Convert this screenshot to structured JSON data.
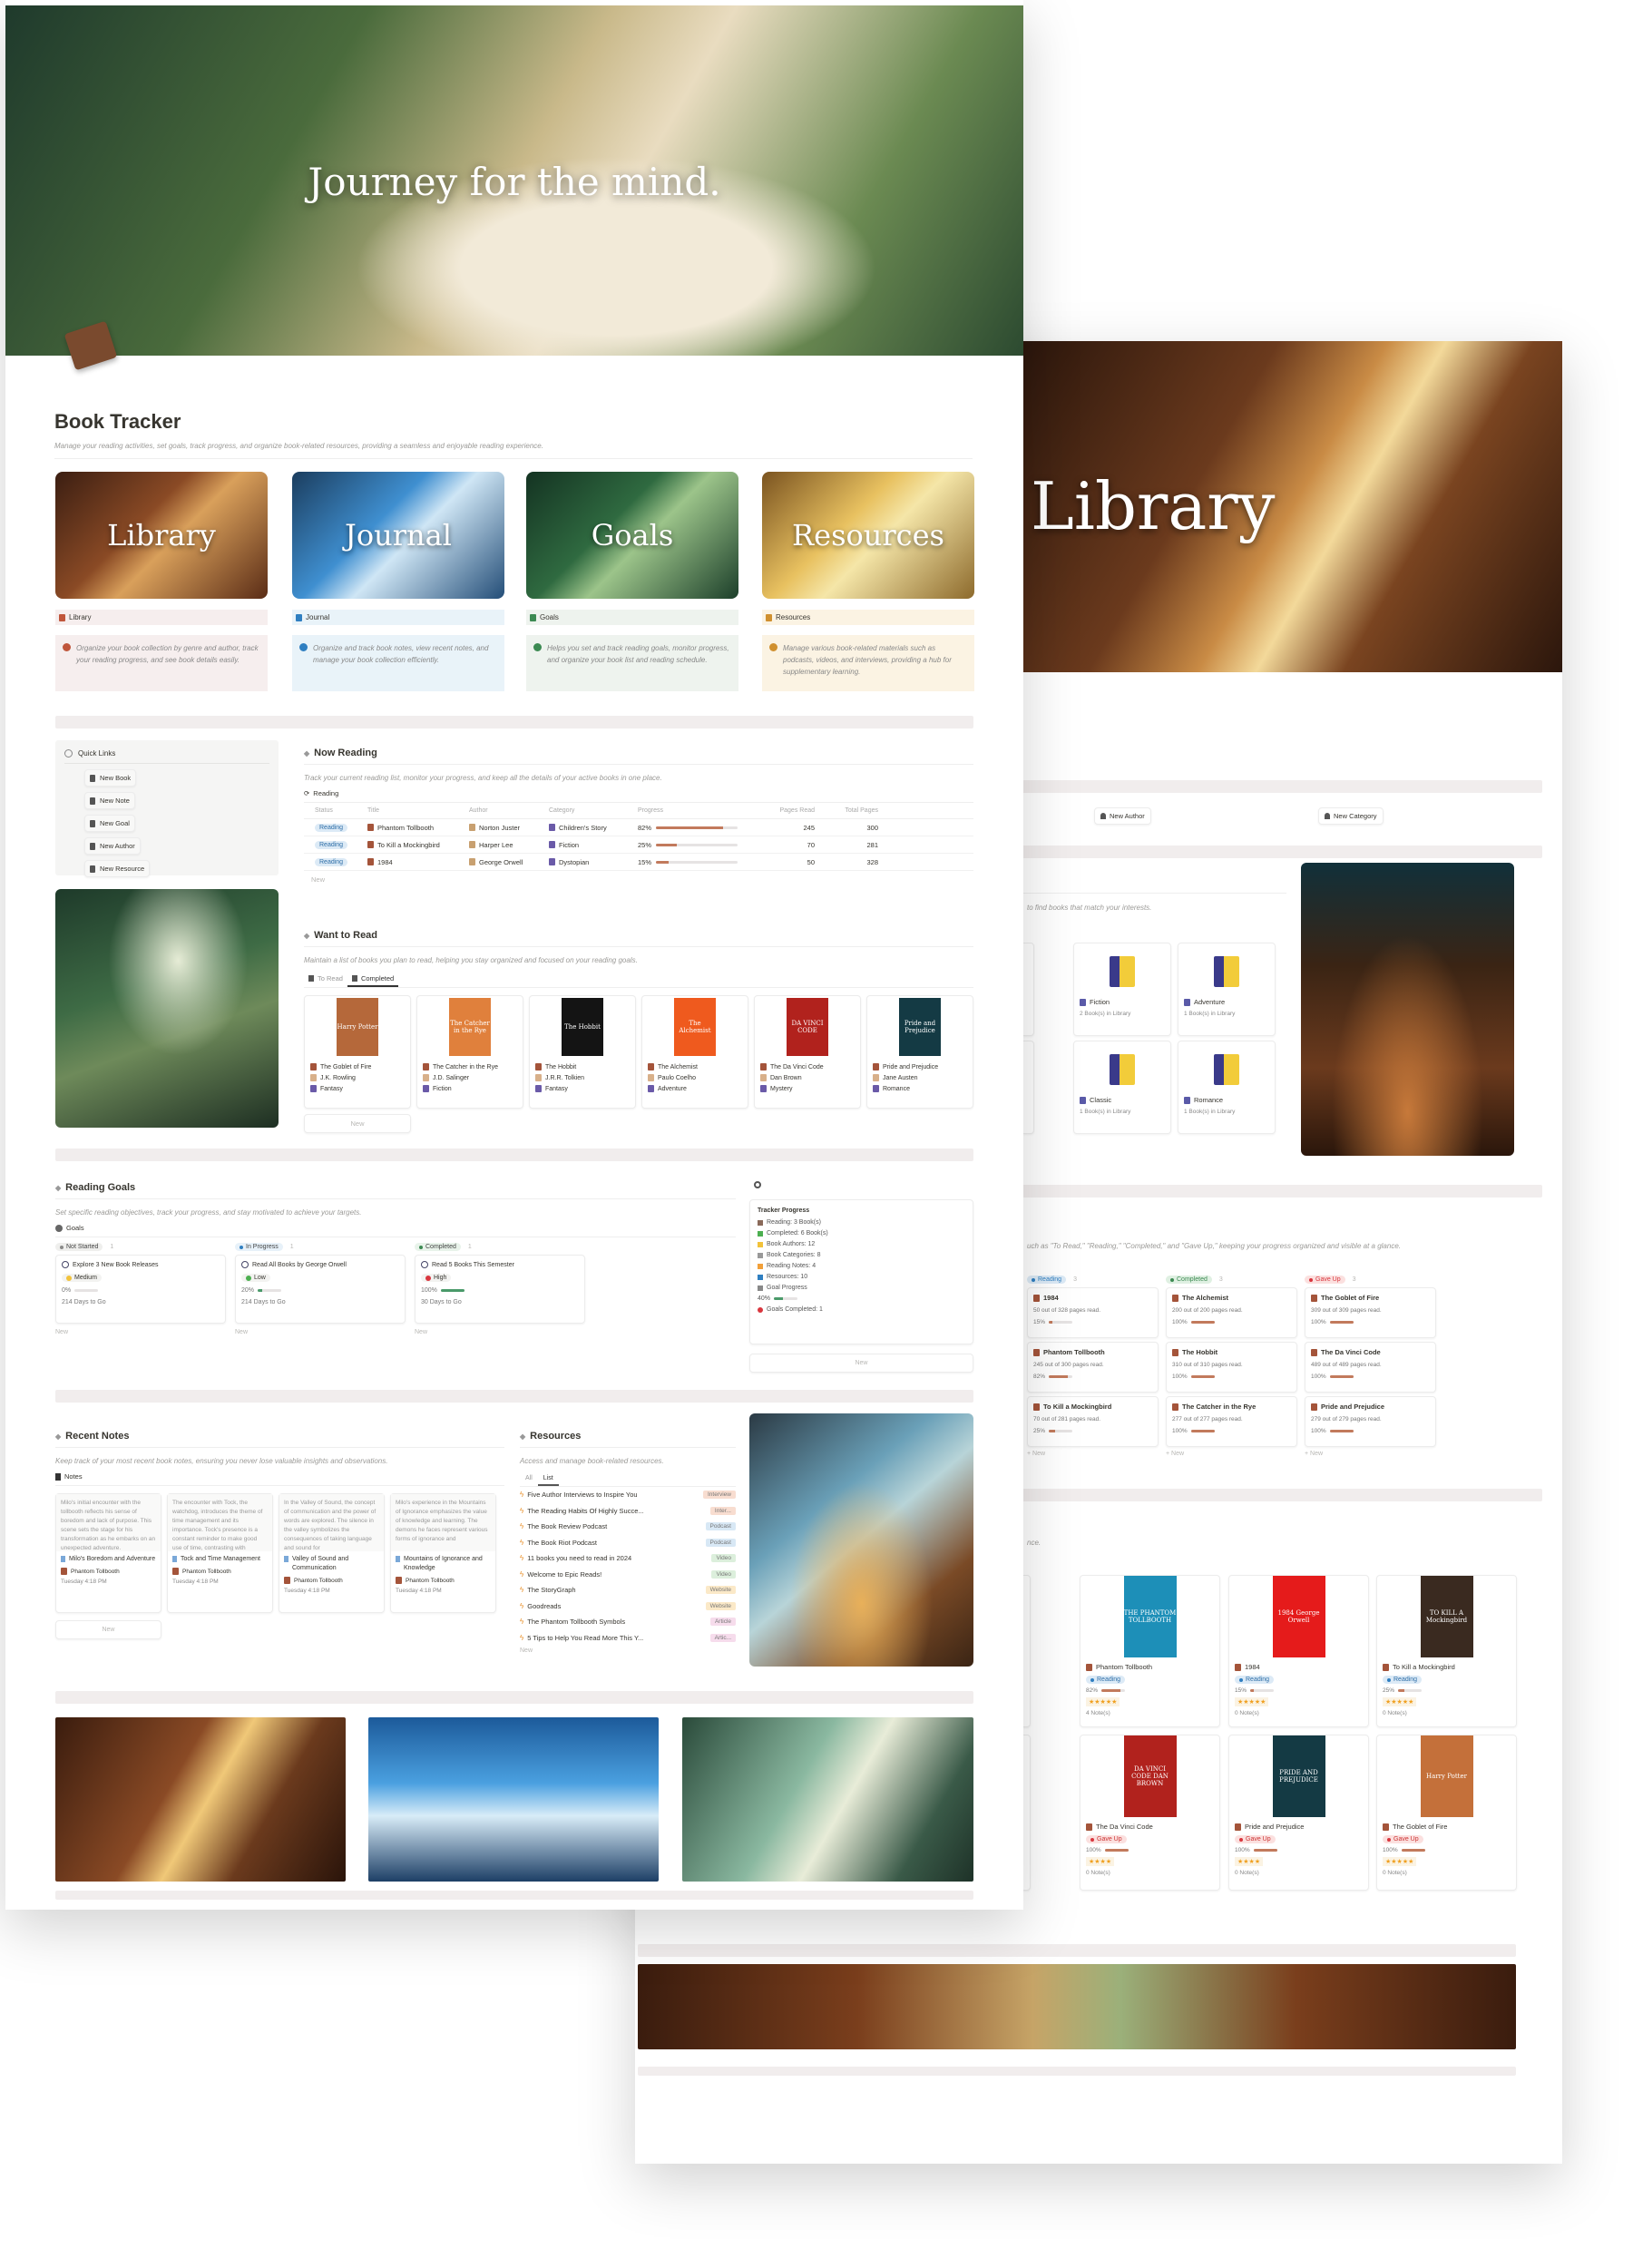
{
  "hero": {
    "title": "Journey for the mind."
  },
  "page": {
    "title": "Book Tracker",
    "subtitle": "Manage your reading activities, set goals, track progress, and organize book-related resources, providing a seamless and enjoyable reading experience."
  },
  "nav_cards": [
    {
      "cover": "Library",
      "label": "Library",
      "desc": "Organize your book collection by genre and author, track your reading progress, and see book details easily.",
      "tint": "#f6eeee",
      "accent": "#c0563b",
      "gradient": "linear-gradient(135deg,#3b1e12,#8a4a25 40%,#d9a05b 55%,#5a2c16)"
    },
    {
      "cover": "Journal",
      "label": "Journal",
      "desc": "Organize and track book notes, view recent notes, and manage your book collection efficiently.",
      "tint": "#e9f3f9",
      "accent": "#2f7fc1",
      "gradient": "linear-gradient(135deg,#1b3d5e,#3f8fd0 40%,#cfe6f5 55%,#244e78)"
    },
    {
      "cover": "Goals",
      "label": "Goals",
      "desc": "Helps you set and track reading goals, monitor progress, and organize your book list and reading schedule.",
      "tint": "#eef3ee",
      "accent": "#3c8a52",
      "gradient": "linear-gradient(135deg,#143322,#2f6a40 40%,#9cc48a 55%,#1c3f2a)"
    },
    {
      "cover": "Resources",
      "label": "Resources",
      "desc": "Manage various book-related materials such as podcasts, videos, and interviews, providing a hub for supplementary learning.",
      "tint": "#fbf3e3",
      "accent": "#d0902f",
      "gradient": "linear-gradient(135deg,#7a5320,#e8c160 40%,#f5e6a8 55%,#8d6a2c)"
    }
  ],
  "quick_links": {
    "title": "Quick Links",
    "items": [
      "New Book",
      "New Note",
      "New Goal",
      "New Author",
      "New Resource"
    ]
  },
  "now_reading": {
    "title": "Now Reading",
    "desc": "Track your current reading list, monitor your progress, and keep all the details of your active books in one place.",
    "view": "Reading",
    "columns": [
      "Status",
      "Title",
      "Author",
      "Category",
      "Progress",
      "Pages Read",
      "Total Pages"
    ],
    "rows": [
      {
        "status": "Reading",
        "title": "Phantom Tollbooth",
        "author": "Norton Juster",
        "category": "Children's Story",
        "progress": 82,
        "progress_label": "82%",
        "pages_read": "245",
        "total_pages": "300"
      },
      {
        "status": "Reading",
        "title": "To Kill a Mockingbird",
        "author": "Harper Lee",
        "category": "Fiction",
        "progress": 25,
        "progress_label": "25%",
        "pages_read": "70",
        "total_pages": "281"
      },
      {
        "status": "Reading",
        "title": "1984",
        "author": "George Orwell",
        "category": "Dystopian",
        "progress": 15,
        "progress_label": "15%",
        "pages_read": "50",
        "total_pages": "328"
      }
    ],
    "new": "New"
  },
  "want_to_read": {
    "title": "Want to Read",
    "desc": "Maintain a list of books you plan to read, helping you stay organized and focused on your reading goals.",
    "tabs": [
      "To Read",
      "Completed"
    ],
    "active_tab": "Completed",
    "books": [
      {
        "title": "The Goblet of Fire",
        "author": "J.K. Rowling",
        "genre": "Fantasy",
        "cover_text": "Harry Potter",
        "cover_color": "#b5683a"
      },
      {
        "title": "The Catcher in the Rye",
        "author": "J.D. Salinger",
        "genre": "Fiction",
        "cover_text": "The Catcher in the Rye",
        "cover_color": "#e0803c"
      },
      {
        "title": "The Hobbit",
        "author": "J.R.R. Tolkien",
        "genre": "Fantasy",
        "cover_text": "The Hobbit",
        "cover_color": "#141414"
      },
      {
        "title": "The Alchemist",
        "author": "Paulo Coelho",
        "genre": "Adventure",
        "cover_text": "The Alchemist",
        "cover_color": "#ef5a1e"
      },
      {
        "title": "The Da Vinci Code",
        "author": "Dan Brown",
        "genre": "Mystery",
        "cover_text": "DA VINCI CODE",
        "cover_color": "#b1221d"
      },
      {
        "title": "Pride and Prejudice",
        "author": "Jane Austen",
        "genre": "Romance",
        "cover_text": "Pride and Prejudice",
        "cover_color": "#143a44"
      }
    ],
    "new": "New"
  },
  "reading_goals": {
    "title": "Reading Goals",
    "desc": "Set specific reading objectives, track your progress, and stay motivated to achieve your targets.",
    "view": "Goals",
    "groups": [
      {
        "name": "Not Started",
        "count": "1",
        "color": "#8a8a8a",
        "bg": "#efefed",
        "card": {
          "title": "Explore 3 New Book Releases",
          "priority": "Medium",
          "priority_color": "#f2c23a",
          "progress": 0,
          "progress_label": "0%",
          "due": "214 Days to Go"
        }
      },
      {
        "name": "In Progress",
        "count": "1",
        "color": "#2f7fc1",
        "bg": "#e7f1f9",
        "card": {
          "title": "Read All Books by George Orwell",
          "priority": "Low",
          "priority_color": "#4caf50",
          "progress": 20,
          "progress_label": "20%",
          "due": "214 Days to Go"
        }
      },
      {
        "name": "Completed",
        "count": "1",
        "color": "#3c8a52",
        "bg": "#e8f3ea",
        "card": {
          "title": "Read 5 Books This Semester",
          "priority": "High",
          "priority_color": "#d9363e",
          "progress": 100,
          "progress_label": "100%",
          "due": "30 Days to Go"
        }
      }
    ],
    "new": "New"
  },
  "tracker": {
    "title": "Tracker Progress",
    "items": [
      "Reading: 3 Book(s)",
      "Completed: 6 Book(s)",
      "Book Authors: 12",
      "Book Categories: 8",
      "Reading Notes: 4",
      "Resources: 10",
      "Goal Progress"
    ],
    "goal_progress": 40,
    "goal_progress_label": "40%",
    "goals_completed": "Goals Completed: 1",
    "new": "New"
  },
  "recent_notes": {
    "title": "Recent Notes",
    "desc": "Keep track of your most recent book notes, ensuring you never lose valuable insights and observations.",
    "view": "Notes",
    "notes": [
      {
        "excerpt": "Milo's initial encounter with the tollbooth reflects his sense of boredom and lack of purpose. This scene sets the stage for his transformation as he embarks on an unexpected adventure.",
        "title": "Milo's Boredom and Adventure",
        "book": "Phantom Tollbooth",
        "date": "Tuesday 4:18 PM"
      },
      {
        "excerpt": "The encounter with Tock, the watchdog, introduces the theme of time management and its importance. Tock's presence is a constant reminder to make good use of time, contrasting with",
        "title": "Tock and Time Management",
        "book": "Phantom Tollbooth",
        "date": "Tuesday 4:18 PM"
      },
      {
        "excerpt": "In the Valley of Sound, the concept of communication and the power of words are explored. The silence in the valley symbolizes the consequences of taking language and sound for",
        "title": "Valley of Sound and Communication",
        "book": "Phantom Tollbooth",
        "date": "Tuesday 4:18 PM"
      },
      {
        "excerpt": "Milo's experience in the Mountains of Ignorance emphasizes the value of knowledge and learning. The demons he faces represent various forms of ignorance and",
        "title": "Mountains of Ignorance and Knowledge",
        "book": "Phantom Tollbooth",
        "date": "Tuesday 4:18 PM"
      }
    ],
    "new": "New"
  },
  "resources": {
    "title": "Resources",
    "desc": "Access and manage book-related resources.",
    "tabs": [
      "All",
      "List"
    ],
    "active_tab": "List",
    "items": [
      {
        "title": "Five Author Interviews to Inspire You",
        "tag": "Interview",
        "color": "#f8ddd0"
      },
      {
        "title": "The Reading Habits Of Highly Succe...",
        "tag": "Inter...",
        "color": "#f8ddd0"
      },
      {
        "title": "The Book Review Podcast",
        "tag": "Podcast",
        "color": "#d8e8f5"
      },
      {
        "title": "The Book Riot Podcast",
        "tag": "Podcast",
        "color": "#d8e8f5"
      },
      {
        "title": "11 books you need to read in 2024",
        "tag": "Video",
        "color": "#dcefdc"
      },
      {
        "title": "Welcome to Epic Reads!",
        "tag": "Video",
        "color": "#dcefdc"
      },
      {
        "title": "The StoryGraph",
        "tag": "Website",
        "color": "#fbe9c8"
      },
      {
        "title": "Goodreads",
        "tag": "Website",
        "color": "#fbe9c8"
      },
      {
        "title": "The Phantom Tollbooth Symbols",
        "tag": "Article",
        "color": "#f6dcec"
      },
      {
        "title": "5 Tips to Help You Read More This Y...",
        "tag": "Artic...",
        "color": "#f6dcec"
      }
    ],
    "new": "New"
  },
  "library_page": {
    "hero_title": "Library",
    "buttons": [
      "New Author",
      "New Category"
    ],
    "categories_desc": "to find books that match your interests.",
    "categories": [
      {
        "name": "Fiction",
        "count": "2 Book(s) in Library"
      },
      {
        "name": "Adventure",
        "count": "1 Book(s) in Library"
      },
      {
        "name": "Classic",
        "count": "1 Book(s) in Library"
      },
      {
        "name": "Romance",
        "count": "1 Book(s) in Library"
      }
    ],
    "status_desc": "uch as \"To Read,\" \"Reading,\" \"Completed,\" and \"Gave Up,\" keeping your progress organized and visible at a glance.",
    "kanban": [
      {
        "name": "Reading",
        "count": "3",
        "color": "#2f7fc1",
        "bg": "#dceaf6",
        "cards": [
          {
            "title": "1984",
            "pages": "50 out of 328 pages read.",
            "progress": 15,
            "label": "15%"
          },
          {
            "title": "Phantom Tollbooth",
            "pages": "245 out of 300 pages read.",
            "progress": 82,
            "label": "82%"
          },
          {
            "title": "To Kill a Mockingbird",
            "pages": "70 out of 281 pages read.",
            "progress": 25,
            "label": "25%"
          }
        ]
      },
      {
        "name": "Completed",
        "count": "3",
        "color": "#3c8a52",
        "bg": "#dff0e2",
        "cards": [
          {
            "title": "The Alchemist",
            "pages": "200 out of 200 pages read.",
            "progress": 100,
            "label": "100%"
          },
          {
            "title": "The Hobbit",
            "pages": "310 out of 310 pages read.",
            "progress": 100,
            "label": "100%"
          },
          {
            "title": "The Catcher in the Rye",
            "pages": "277 out of 277 pages read.",
            "progress": 100,
            "label": "100%"
          }
        ]
      },
      {
        "name": "Gave Up",
        "count": "3",
        "color": "#d9363e",
        "bg": "#fbe0df",
        "cards": [
          {
            "title": "The Goblet of Fire",
            "pages": "309 out of 309 pages read.",
            "progress": 100,
            "label": "100%"
          },
          {
            "title": "The Da Vinci Code",
            "pages": "489 out of 489 pages read.",
            "progress": 100,
            "label": "100%"
          },
          {
            "title": "Pride and Prejudice",
            "pages": "279 out of 279 pages read.",
            "progress": 100,
            "label": "100%"
          }
        ]
      }
    ],
    "gallery_desc": "nce.",
    "gallery": [
      {
        "title": "Phantom Tollbooth",
        "status": "Reading",
        "progress": 82,
        "label": "82%",
        "rating": 5,
        "notes": "4 Note(s)",
        "cover_text": "THE PHANTOM TOLLBOOTH",
        "cover_color": "#1d8fb8"
      },
      {
        "title": "1984",
        "status": "Reading",
        "progress": 15,
        "label": "15%",
        "rating": 5,
        "notes": "0 Note(s)",
        "cover_text": "1984 George Orwell",
        "cover_color": "#e51b1b"
      },
      {
        "title": "To Kill a Mockingbird",
        "status": "Reading",
        "progress": 25,
        "label": "25%",
        "rating": 5,
        "notes": "0 Note(s)",
        "cover_text": "TO KILL A Mockingbird",
        "cover_color": "#3a2a20"
      },
      {
        "title": "The Da Vinci Code",
        "status": "Gave Up",
        "progress": 100,
        "label": "100%",
        "rating": 4,
        "notes": "0 Note(s)",
        "cover_text": "DA VINCI CODE DAN BROWN",
        "cover_color": "#b1221d"
      },
      {
        "title": "Pride and Prejudice",
        "status": "Gave Up",
        "progress": 100,
        "label": "100%",
        "rating": 4,
        "notes": "0 Note(s)",
        "cover_text": "PRIDE AND PREJUDICE",
        "cover_color": "#143a44"
      },
      {
        "title": "The Goblet of Fire",
        "status": "Gave Up",
        "progress": 100,
        "label": "100%",
        "rating": 5,
        "notes": "0 Note(s)",
        "cover_text": "Harry Potter",
        "cover_color": "#c4703a"
      }
    ]
  },
  "colors": {
    "progress": "#c27a5c",
    "goal_bar": "#4a9a6a",
    "star": "#f0a020"
  }
}
